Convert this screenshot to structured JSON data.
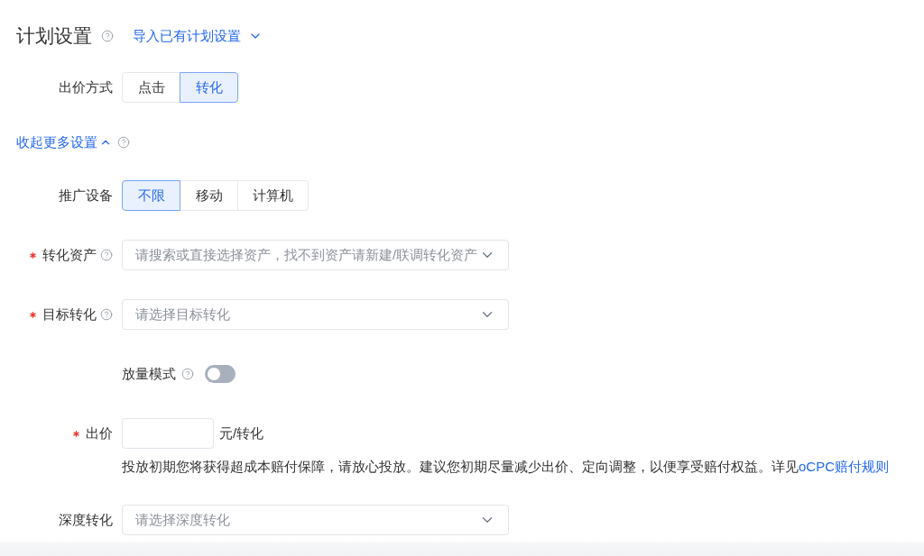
{
  "header": {
    "title": "计划设置",
    "import_link": "导入已有计划设置"
  },
  "bid_method": {
    "label": "出价方式",
    "options": [
      {
        "label": "点击",
        "selected": false
      },
      {
        "label": "转化",
        "selected": true
      }
    ]
  },
  "more_settings": {
    "label": "收起更多设置",
    "expanded": true,
    "fields": [
      {
        "kind": "segmented",
        "label": "推广设备",
        "required": false,
        "help": false,
        "options": [
          {
            "label": "不限",
            "selected": true
          },
          {
            "label": "移动",
            "selected": false
          },
          {
            "label": "计算机",
            "selected": false
          }
        ]
      },
      {
        "kind": "select",
        "label": "转化资产",
        "required": true,
        "help": true,
        "placeholder": "请搜索或直接选择资产，找不到资产请新建/联调转化资产"
      },
      {
        "kind": "select",
        "label": "目标转化",
        "required": true,
        "help": true,
        "placeholder": "请选择目标转化"
      },
      {
        "kind": "switch",
        "label": "放量模式",
        "required": false,
        "help": true,
        "on": false
      },
      {
        "kind": "price",
        "label": "出价",
        "required": true,
        "help": false,
        "unit": "元/转化",
        "note": "投放初期您将获得超成本赔付保障，请放心投放。建议您初期尽量减少出价、定向调整，以便享受赔付权益。详见",
        "note_link": "oCPC赔付规则"
      },
      {
        "kind": "select",
        "label": "深度转化",
        "required": false,
        "help": false,
        "placeholder": "请选择深度转化"
      }
    ]
  }
}
